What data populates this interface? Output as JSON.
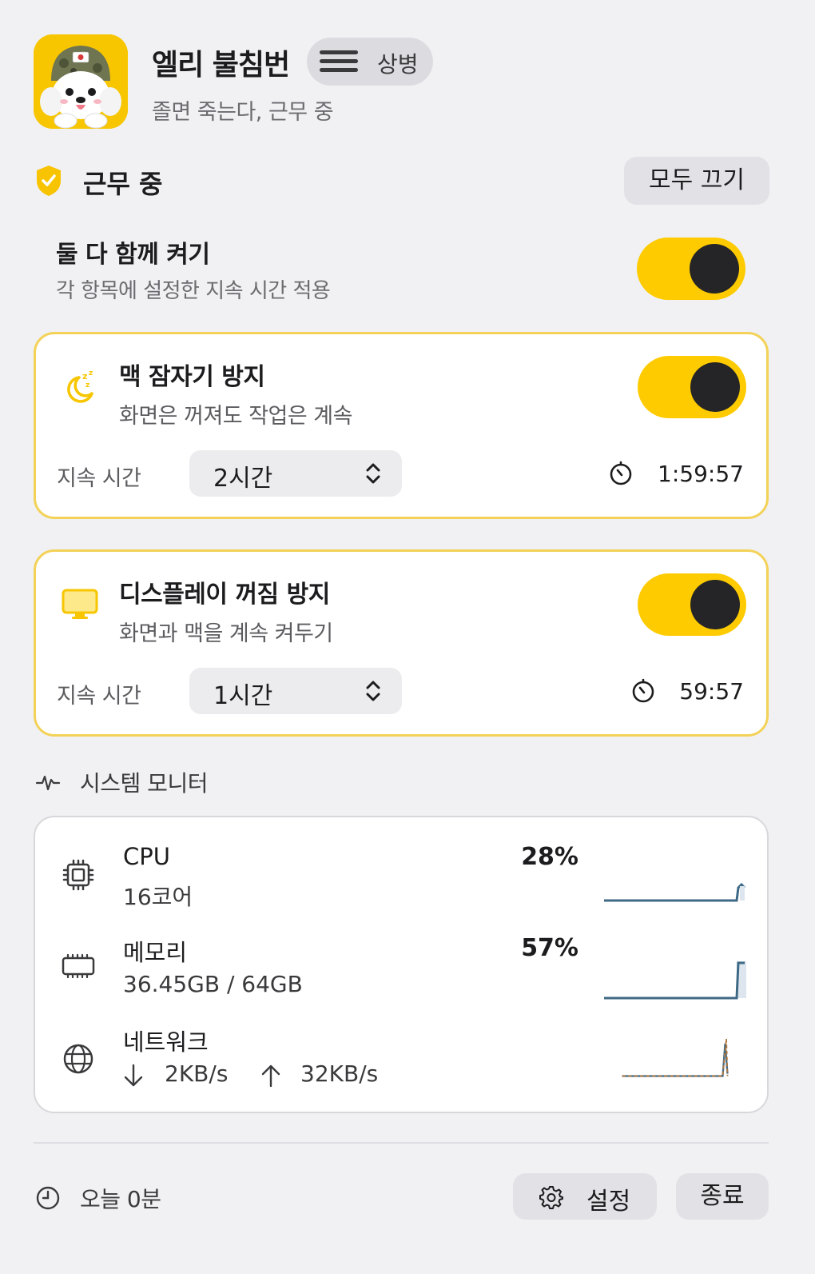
{
  "header": {
    "app_name": "엘리 불침번",
    "rank": "상병",
    "tagline": "졸면 죽는다, 근무 중"
  },
  "status": {
    "label": "근무 중",
    "all_off_label": "모두 끄기"
  },
  "both_on": {
    "title": "둘 다 함께 켜기",
    "subtitle": "각 항목에 설정한 지속 시간 적용",
    "enabled": true
  },
  "cards": [
    {
      "title": "맥 잠자기 방지",
      "subtitle": "화면은 꺼져도 작업은 계속",
      "icon": "moon-zzz-icon",
      "enabled": true,
      "duration_label": "지속 시간",
      "duration_value": "2시간",
      "remaining": "1:59:57"
    },
    {
      "title": "디스플레이 꺼짐 방지",
      "subtitle": "화면과 맥을 계속 켜두기",
      "icon": "display-icon",
      "enabled": true,
      "duration_label": "지속 시간",
      "duration_value": "1시간",
      "remaining": "59:57"
    }
  ],
  "monitor": {
    "title": "시스템 모니터",
    "cpu": {
      "name": "CPU",
      "detail": "16코어",
      "percent": "28%"
    },
    "memory": {
      "name": "메모리",
      "detail": "36.45GB / 64GB",
      "percent": "57%"
    },
    "network": {
      "name": "네트워크",
      "down": "2KB/s",
      "up": "32KB/s"
    }
  },
  "footer": {
    "today": "오늘 0분",
    "settings_label": "설정",
    "quit_label": "종료"
  },
  "colors": {
    "accent": "#fecb00",
    "card_border": "#f3d257",
    "spark_line": "#3f6a86",
    "network_up": "#b07840"
  }
}
